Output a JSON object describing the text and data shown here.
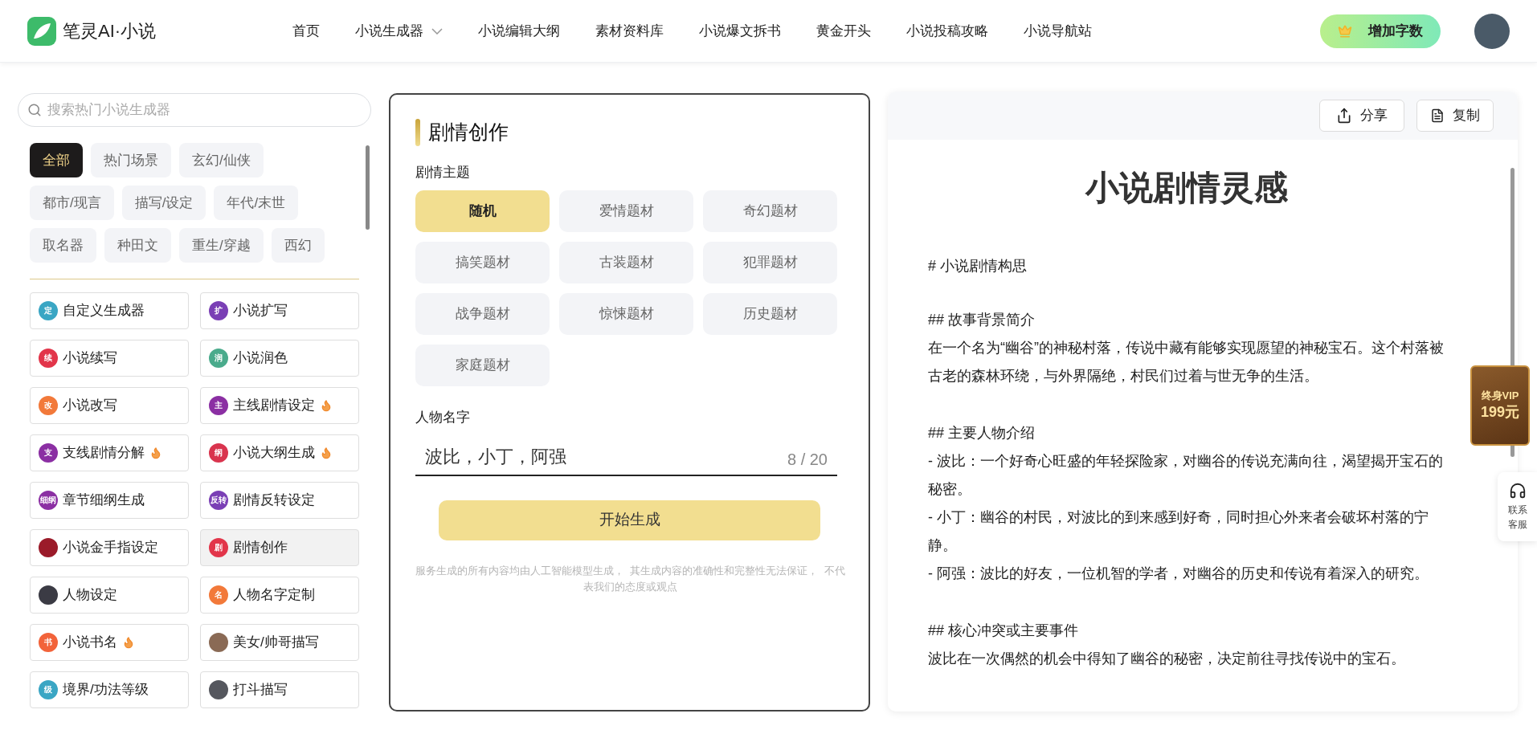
{
  "header": {
    "logo_text": "笔灵AI·小说",
    "nav": [
      {
        "label": "首页",
        "dropdown": false
      },
      {
        "label": "小说生成器",
        "dropdown": true
      },
      {
        "label": "小说编辑大纲",
        "dropdown": false
      },
      {
        "label": "素材资料库",
        "dropdown": false
      },
      {
        "label": "小说爆文拆书",
        "dropdown": false
      },
      {
        "label": "黄金开头",
        "dropdown": false
      },
      {
        "label": "小说投稿攻略",
        "dropdown": false
      },
      {
        "label": "小说导航站",
        "dropdown": false
      }
    ],
    "cta": "增加字数"
  },
  "sidebar": {
    "search": {
      "placeholder": "搜索热门小说生成器"
    },
    "categories": [
      {
        "label": "全部",
        "selected": true
      },
      {
        "label": "热门场景",
        "selected": false
      },
      {
        "label": "玄幻/仙侠",
        "selected": false
      },
      {
        "label": "都市/现言",
        "selected": false
      },
      {
        "label": "描写/设定",
        "selected": false
      },
      {
        "label": "年代/末世",
        "selected": false
      },
      {
        "label": "取名器",
        "selected": false
      },
      {
        "label": "种田文",
        "selected": false
      },
      {
        "label": "重生/穿越",
        "selected": false
      },
      {
        "label": "西幻",
        "selected": false
      }
    ],
    "tools": [
      {
        "label": "自定义生成器",
        "kind": "glyph",
        "badge": "定",
        "color": "#3aa6c4",
        "hot": false,
        "selected": false
      },
      {
        "label": "小说扩写",
        "kind": "glyph",
        "badge": "扩",
        "color": "#7a3fb5",
        "hot": false,
        "selected": false
      },
      {
        "label": "小说续写",
        "kind": "glyph",
        "badge": "续",
        "color": "#e2354a",
        "hot": false,
        "selected": false
      },
      {
        "label": "小说润色",
        "kind": "glyph",
        "badge": "润",
        "color": "#4aab8c",
        "hot": false,
        "selected": false
      },
      {
        "label": "小说改写",
        "kind": "glyph",
        "badge": "改",
        "color": "#f2793a",
        "hot": false,
        "selected": false
      },
      {
        "label": "主线剧情设定",
        "kind": "glyph",
        "badge": "主",
        "color": "#8b2fa3",
        "hot": true,
        "selected": false
      },
      {
        "label": "支线剧情分解",
        "kind": "glyph",
        "badge": "支",
        "color": "#8b2fa3",
        "hot": true,
        "selected": false
      },
      {
        "label": "小说大纲生成",
        "kind": "glyph",
        "badge": "纲",
        "color": "#d9344e",
        "hot": true,
        "selected": false
      },
      {
        "label": "章节细纲生成",
        "kind": "glyph",
        "badge": "细纲",
        "color": "#8b2fa3",
        "hot": false,
        "selected": false
      },
      {
        "label": "剧情反转设定",
        "kind": "glyph",
        "badge": "反转",
        "color": "#7a3fb5",
        "hot": false,
        "selected": false
      },
      {
        "label": "小说金手指设定",
        "kind": "photo",
        "color": "#9b1b2a",
        "hot": false,
        "selected": false
      },
      {
        "label": "剧情创作",
        "kind": "glyph",
        "badge": "剧",
        "color": "#e2354a",
        "hot": false,
        "selected": true
      },
      {
        "label": "人物设定",
        "kind": "photo",
        "color": "#3b3b44",
        "hot": false,
        "selected": false
      },
      {
        "label": "人物名字定制",
        "kind": "glyph",
        "badge": "名",
        "color": "#f2793a",
        "hot": false,
        "selected": false
      },
      {
        "label": "小说书名",
        "kind": "glyph",
        "badge": "书",
        "color": "#f2633a",
        "hot": true,
        "selected": false
      },
      {
        "label": "美女/帅哥描写",
        "kind": "photo",
        "color": "#8a6a55",
        "hot": false,
        "selected": false
      },
      {
        "label": "境界/功法等级",
        "kind": "glyph",
        "badge": "级",
        "color": "#3aa6c4",
        "hot": false,
        "selected": false
      },
      {
        "label": "打斗描写",
        "kind": "photo",
        "color": "#55575e",
        "hot": false,
        "selected": false
      }
    ]
  },
  "form": {
    "title": "剧情创作",
    "theme_label": "剧情主题",
    "themes": [
      {
        "label": "随机",
        "selected": true
      },
      {
        "label": "爱情题材",
        "selected": false
      },
      {
        "label": "奇幻题材",
        "selected": false
      },
      {
        "label": "搞笑题材",
        "selected": false
      },
      {
        "label": "古装题材",
        "selected": false
      },
      {
        "label": "犯罪题材",
        "selected": false
      },
      {
        "label": "战争题材",
        "selected": false
      },
      {
        "label": "惊悚题材",
        "selected": false
      },
      {
        "label": "历史题材",
        "selected": false
      },
      {
        "label": "家庭题材",
        "selected": false
      }
    ],
    "name_label": "人物名字",
    "name_value": "波比，小丁，阿强",
    "name_count": "8 / 20",
    "generate": "开始生成",
    "disclaimer": "服务生成的所有内容均由人工智能模型生成，  其生成内容的准确性和完整性无法保证，  不代表我们的态度或观点"
  },
  "result": {
    "share": "分享",
    "copy": "复制",
    "title": "小说剧情灵感",
    "blocks": [
      {
        "kind": "h1",
        "text": "# 小说剧情构思"
      },
      {
        "kind": "h2",
        "text": "## 故事背景简介"
      },
      {
        "kind": "p",
        "text": "在一个名为“幽谷”的神秘村落，传说中藏有能够实现愿望的神秘宝石。这个村落被古老的森林环绕，与外界隔绝，村民们过着与世无争的生活。"
      },
      {
        "kind": "h2",
        "text": "## 主要人物介绍"
      },
      {
        "kind": "p",
        "text": "- 波比：一个好奇心旺盛的年轻探险家，对幽谷的传说充满向往，渴望揭开宝石的秘密。"
      },
      {
        "kind": "p",
        "text": "- 小丁：幽谷的村民，对波比的到来感到好奇，同时担心外来者会破坏村落的宁静。"
      },
      {
        "kind": "p",
        "text": "- 阿强：波比的好友，一位机智的学者，对幽谷的历史和传说有着深入的研究。"
      },
      {
        "kind": "h2",
        "text": "## 核心冲突或主要事件"
      },
      {
        "kind": "p",
        "text": "波比在一次偶然的机会中得知了幽谷的秘密，决定前往寻找传说中的宝石。"
      }
    ]
  },
  "vip_badge": {
    "line_1": "终身VIP",
    "line_2": "199元"
  },
  "support": {
    "line_1": "联系",
    "line_2": "客服"
  }
}
